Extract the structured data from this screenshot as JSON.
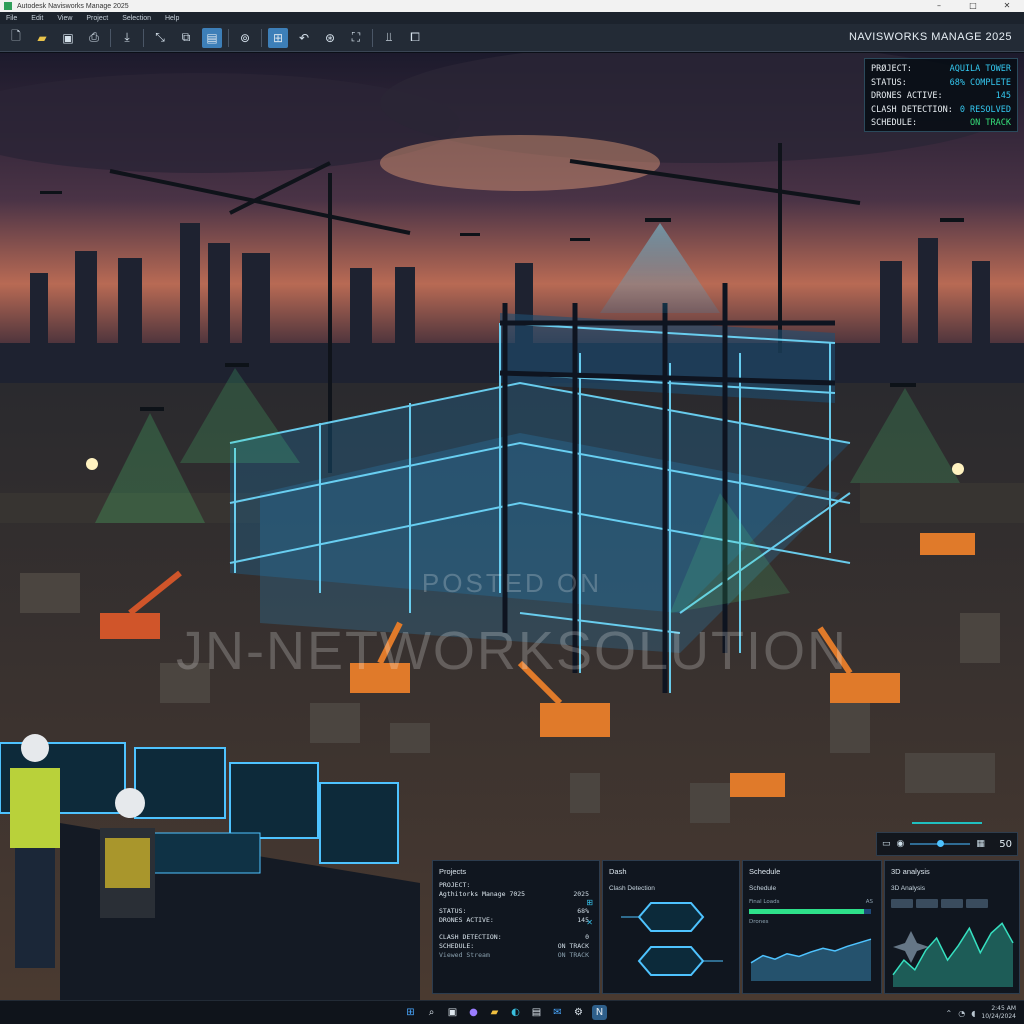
{
  "window": {
    "title": "Autodesk Navisworks Manage 2025",
    "controls": [
      "–",
      "□",
      "✕"
    ]
  },
  "menu": [
    "File",
    "Edit",
    "View",
    "Project",
    "Selection",
    "Help"
  ],
  "toolbar": {
    "brand": "NAVISWORKS MANAGE 2025",
    "icons": [
      "new-file-icon",
      "open-folder-icon",
      "save-icon",
      "print-icon",
      "import-icon",
      "measure-icon",
      "select-icon",
      "section-icon",
      "orbit-icon",
      "walk-icon",
      "undo-icon",
      "clash-icon",
      "fit-icon",
      "timeliner-icon",
      "viewpoint-icon"
    ]
  },
  "status_overlay": {
    "project_label": "PRØJECT:",
    "project_value": "AQUILA TOWER",
    "status_label": "STATUS:",
    "status_value": "68% COMPLETE",
    "drones_label": "DRONES ACTIVE:",
    "drones_value": "145",
    "clash_label": "CLASH DETECTION:",
    "clash_value": "0 RESOLVED",
    "schedule_label": "SCHEDULE:",
    "schedule_value": "ON TRACK"
  },
  "watermark": {
    "line1": "POSTED ON",
    "line2": "JN-NETWORKSOLUTION"
  },
  "viewport_controls": {
    "zoom": "50",
    "slider_level": 0.45
  },
  "panels": {
    "project": {
      "title": "Projects",
      "rows": [
        {
          "k": "PROJECT:",
          "v": ""
        },
        {
          "k": "Agthitorks Manage 7025",
          "v": "2025"
        },
        {
          "k": "STATUS:",
          "v": "68%"
        },
        {
          "k": "DRONES ACTIVE:",
          "v": "145"
        },
        {
          "k": "CLASH DETECTION:",
          "v": "0"
        },
        {
          "k": "SCHEDULE:",
          "v": "ON TRACK"
        },
        {
          "k": "Viewed Stream",
          "v": "ON TRACK"
        }
      ]
    },
    "clash": {
      "title": "Dash",
      "subtitle": "Clash Detection"
    },
    "schedule": {
      "title": "Schedule",
      "subtitle": "Schedule",
      "bar_label": "Final Loads",
      "bar_value": "AS",
      "progress": 0.94,
      "chart_label": "Drones",
      "chart_values": [
        20,
        28,
        24,
        30,
        27,
        32,
        36,
        33,
        38,
        42,
        46
      ]
    },
    "analysis": {
      "title": "3D analysis",
      "subtitle": "3D Analysis",
      "chips": [
        "",
        "",
        "",
        ""
      ],
      "chart_values": [
        10,
        22,
        14,
        30,
        40,
        22,
        34,
        48,
        28,
        44,
        52,
        36
      ]
    }
  },
  "taskbar": {
    "apps": [
      "windows-start-icon",
      "search-icon",
      "widgets-icon",
      "chat-icon",
      "explorer-icon",
      "edge-icon",
      "store-icon",
      "mail-icon",
      "settings-icon",
      "navisworks-icon"
    ],
    "time": "2:45 AM",
    "date": "10/24/2024"
  },
  "colors": {
    "accent": "#34c8f0",
    "ok": "#36e07a",
    "toolbar_bg": "#232b36"
  }
}
